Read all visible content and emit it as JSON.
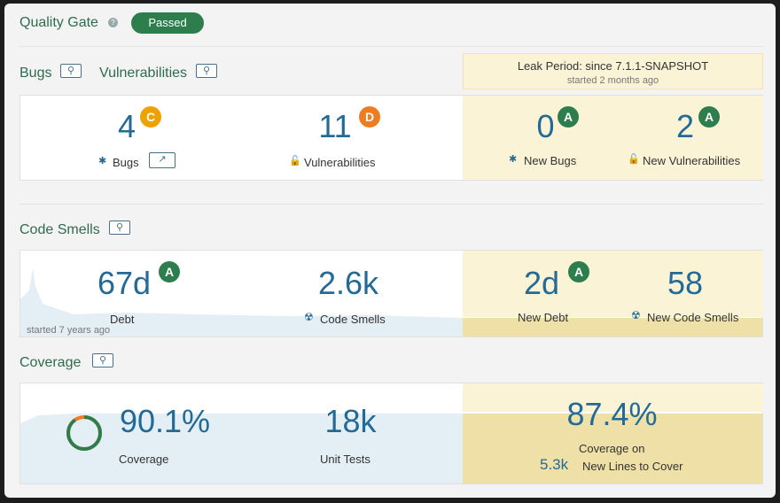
{
  "header": {
    "title": "Quality Gate",
    "status": "Passed"
  },
  "bugs_vulns": {
    "bugs_title": "Bugs",
    "vulns_title": "Vulnerabilities",
    "leak_period": "Leak Period: since 7.1.1-SNAPSHOT",
    "leak_started": "started 2 months ago",
    "bugs": {
      "value": "4",
      "rating": "C",
      "label": "Bugs"
    },
    "vulns": {
      "value": "11",
      "rating": "D",
      "label": "Vulnerabilities"
    },
    "new_bugs": {
      "value": "0",
      "rating": "A",
      "label": "New Bugs"
    },
    "new_vulns": {
      "value": "2",
      "rating": "A",
      "label": "New Vulnerabilities"
    }
  },
  "code_smells": {
    "title": "Code Smells",
    "debt": {
      "value": "67d",
      "rating": "A",
      "label": "Debt"
    },
    "smells": {
      "value": "2.6k",
      "label": "Code Smells"
    },
    "started": "started 7 years ago",
    "new_debt": {
      "value": "2d",
      "rating": "A",
      "label": "New Debt"
    },
    "new_smells": {
      "value": "58",
      "label": "New Code Smells"
    }
  },
  "coverage": {
    "title": "Coverage",
    "coverage": {
      "value": "90.1%",
      "label": "Coverage",
      "fraction": 0.901
    },
    "tests": {
      "value": "18k",
      "label": "Unit Tests"
    },
    "new_coverage": {
      "value": "87.4%",
      "label": "Coverage on"
    },
    "new_lines": {
      "value": "5.3k",
      "label": "New Lines to Cover"
    }
  },
  "colors": {
    "passed": "#2e7d4d",
    "leak_bg": "#fbf3d5",
    "rating_a": "#2e7d4d",
    "rating_c": "#eca200",
    "rating_d": "#ed7d20"
  }
}
